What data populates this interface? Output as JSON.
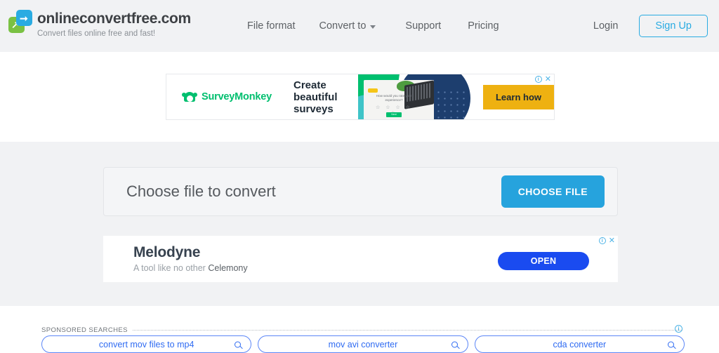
{
  "header": {
    "brand_name": "onlineconvertfree.com",
    "brand_tagline": "Convert files online free and fast!",
    "nav": [
      {
        "label": "File format",
        "has_caret": false
      },
      {
        "label": "Convert to",
        "has_caret": true
      },
      {
        "label": "Support",
        "has_caret": false
      },
      {
        "label": "Pricing",
        "has_caret": false
      }
    ],
    "login_label": "Login",
    "signup_label": "Sign Up",
    "accent_color": "#29abe2",
    "background_color": "#f1f2f4"
  },
  "top_ad": {
    "advertiser": "SurveyMonkey",
    "advertiser_trademark": "®",
    "headline": "Create beautiful surveys",
    "cta_label": "Learn how",
    "cta_color": "#eeb111",
    "brand_color": "#00bf6f",
    "creative_question": "How would you rate your experience?",
    "creative_stars": "☆ ☆ ☆ ☆ ☆",
    "creative_button": "Next",
    "adchoices_icon": "info-icon",
    "close_icon": "close-icon"
  },
  "main": {
    "choose_title": "Choose file to convert",
    "choose_button_label": "CHOOSE FILE",
    "choose_button_color": "#26a3dd",
    "background_color": "#f1f2f4"
  },
  "inline_ad": {
    "title": "Melodyne",
    "subtitle": "A tool like no other",
    "advertiser": "Celemony",
    "cta_label": "OPEN",
    "cta_color": "#1a4bf0",
    "adchoices_icon": "info-icon",
    "close_icon": "close-icon"
  },
  "sponsored_searches": {
    "section_label": "SPONSORED SEARCHES",
    "info_icon": "info-icon",
    "items": [
      {
        "query": "convert mov files to mp4",
        "icon": "search-icon"
      },
      {
        "query": "mov avi converter",
        "icon": "search-icon"
      },
      {
        "query": "cda converter",
        "icon": "search-icon"
      }
    ],
    "link_color": "#2f6bf2"
  }
}
